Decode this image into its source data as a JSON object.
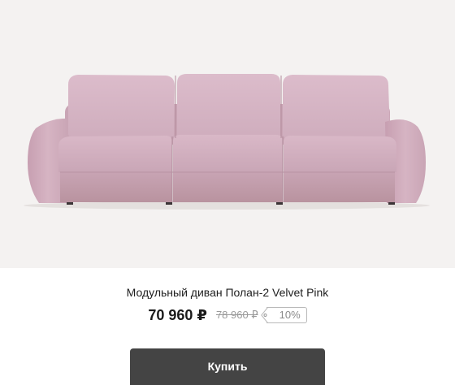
{
  "product": {
    "image": {
      "subject": "sofa",
      "upholstery_color": "#d8b8c6",
      "background_color": "#f4f2f1"
    },
    "name": "Модульный диван Полан-2 Velvet Pink",
    "price": {
      "current": "70 960 ₽",
      "old": "78 960 ₽",
      "discount": "10%"
    },
    "buy_label": "Купить"
  },
  "colors": {
    "button_bg": "#444444",
    "button_text": "#ffffff",
    "old_price": "#9a9a9a",
    "badge_border": "#b9b9b9"
  }
}
